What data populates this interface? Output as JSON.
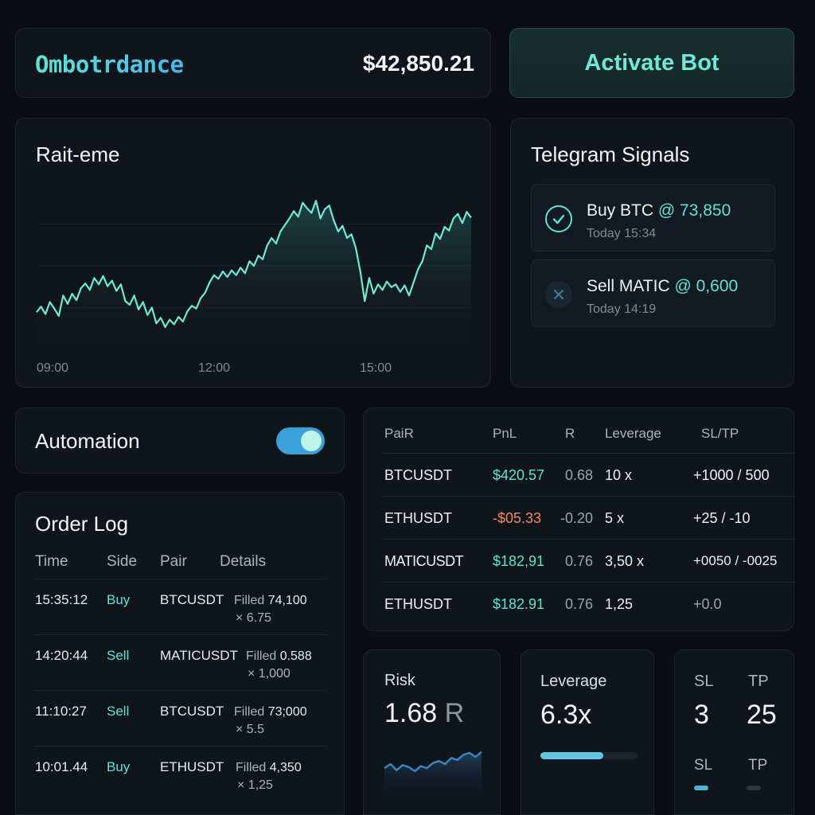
{
  "header": {
    "logo": "Ombotrdance",
    "price": "$42,850.21",
    "activate_label": "Activate Bot"
  },
  "chart": {
    "title": "Rait-eme",
    "x_ticks": [
      "09:00",
      "12:00",
      "15:00"
    ]
  },
  "chart_data": {
    "type": "area",
    "title": "Rait-eme",
    "x_ticks": [
      "09:00",
      "12:00",
      "15:00"
    ],
    "values": [
      40,
      46,
      38,
      51,
      44,
      36,
      58,
      49,
      60,
      53,
      66,
      71,
      64,
      77,
      70,
      79,
      68,
      74,
      63,
      70,
      52,
      48,
      58,
      43,
      51,
      37,
      45,
      28,
      34,
      24,
      32,
      27,
      35,
      30,
      41,
      47,
      44,
      55,
      61,
      72,
      80,
      76,
      84,
      78,
      85,
      80,
      88,
      82,
      95,
      90,
      101,
      97,
      112,
      120,
      114,
      127,
      134,
      141,
      149,
      143,
      158,
      152,
      147,
      160,
      141,
      151,
      155,
      139,
      127,
      133,
      120,
      124,
      109,
      84,
      52,
      77,
      60,
      70,
      64,
      73,
      67,
      70,
      62,
      69,
      58,
      72,
      86,
      95,
      112,
      108,
      125,
      119,
      132,
      128,
      141,
      146,
      136,
      148,
      142
    ],
    "ylim": [
      0,
      180
    ],
    "grid": true
  },
  "telegram": {
    "title": "Telegram Signals",
    "signals": [
      {
        "label": "Buy BTC",
        "price": "@ 73,850",
        "time": "Today 15:34",
        "status": "check-icon",
        "color": "#5fe3d6"
      },
      {
        "label": "Sell MATIC",
        "price": "@ 0,600",
        "time": "Today 14:19",
        "status": "x-icon",
        "color": "#3f7f9a"
      }
    ]
  },
  "automation": {
    "label": "Automation",
    "enabled": true
  },
  "order_log": {
    "title": "Order Log",
    "headers": [
      "Time",
      "Side",
      "Pair",
      "Details"
    ],
    "rows": [
      {
        "time": "15:35:12",
        "side": "Buy",
        "pair": "BTCUSDT",
        "filled_label": "Filled",
        "filled": "74,100",
        "qty": "× 6.75"
      },
      {
        "time": "14:20:44",
        "side": "Sell",
        "pair": "MATICUSDT",
        "filled_label": "Filled",
        "filled": "0.588",
        "qty": "× 1,000"
      },
      {
        "time": "11:10:27",
        "side": "Sell",
        "pair": "BTCUSDT",
        "filled_label": "Filled",
        "filled": "73;000",
        "qty": "× 5.5"
      },
      {
        "time": "10:01.44",
        "side": "Buy",
        "pair": "ETHUSDT",
        "filled_label": "Filled",
        "filled": "4,350",
        "qty": "× 1,25"
      }
    ]
  },
  "positions": {
    "headers": [
      "PaiR",
      "PnL",
      "R",
      "Leverage",
      "SL/TP"
    ],
    "rows": [
      {
        "pair": "BTCUSDT",
        "pnl": "$420.57",
        "pnl_sign": "pos",
        "r": "0.68",
        "leverage": "10 x",
        "sltp": "+1000 / 500"
      },
      {
        "pair": "ETHUSDT",
        "pnl": "-$05.33",
        "pnl_sign": "neg",
        "r": "-0.20",
        "leverage": "5 x",
        "sltp": "+25 / -10"
      },
      {
        "pair": "MATICUSDT",
        "pnl": "$182,91",
        "pnl_sign": "pos",
        "r": "0.76",
        "leverage": "3,50 x",
        "sltp": "+0050 / -0025"
      },
      {
        "pair": "ETHUSDT",
        "pnl": "$182.91",
        "pnl_sign": "pos",
        "r": "0.76",
        "leverage": "1,25",
        "sltp": "+0.0"
      }
    ]
  },
  "risk": {
    "title": "Risk",
    "value": "1.68",
    "unit": "R",
    "spark": [
      14,
      18,
      12,
      17,
      15,
      11,
      16,
      14,
      19,
      21,
      18,
      24,
      22,
      27,
      29,
      25,
      30
    ]
  },
  "leverage": {
    "title": "Leverage",
    "value": "6.3x",
    "fill_fraction": 0.65
  },
  "sltp": {
    "sl_label": "SL",
    "tp_label": "TP",
    "sl_value": "3",
    "tp_value": "25",
    "sl_label2": "SL",
    "tp_label2": "TP"
  }
}
